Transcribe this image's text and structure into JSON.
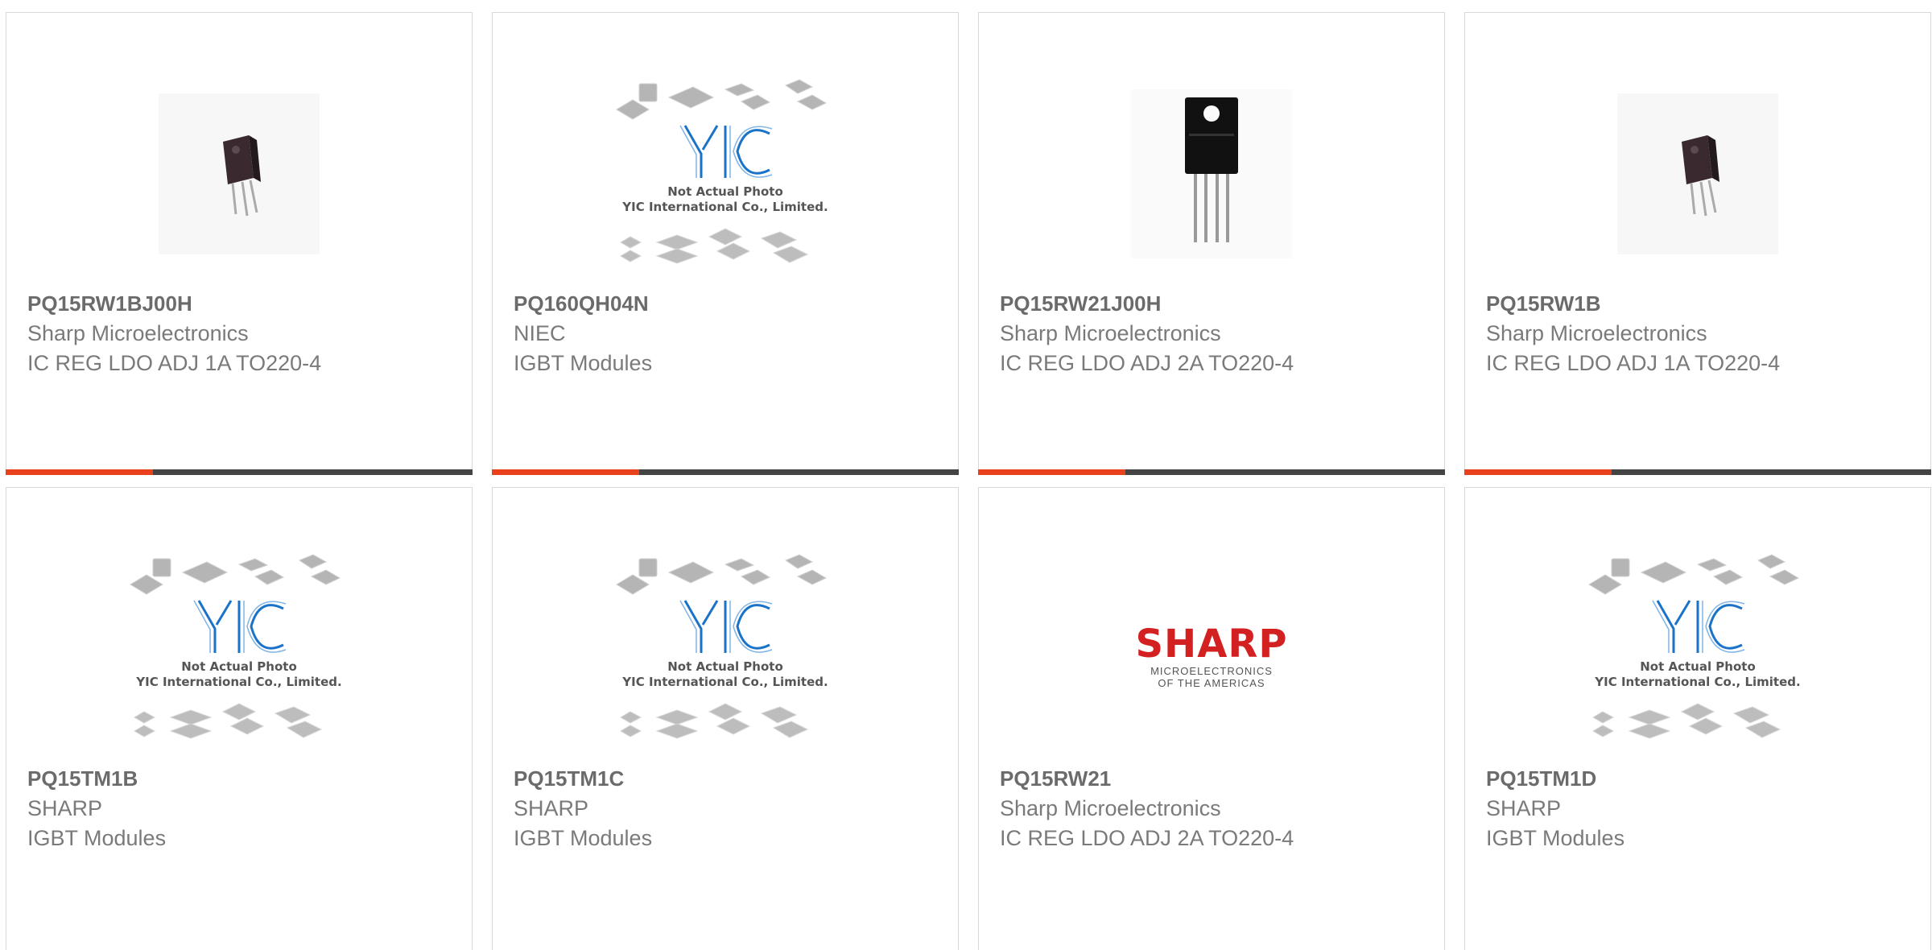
{
  "products": [
    {
      "part": "PQ15RW1BJ00H",
      "maker": "Sharp Microelectronics",
      "desc": "IC REG LDO ADJ 1A TO220-4",
      "image": "to220-small-photo"
    },
    {
      "part": "PQ160QH04N",
      "maker": "NIEC",
      "desc": "IGBT Modules",
      "image": "yic-placeholder"
    },
    {
      "part": "PQ15RW21J00H",
      "maker": "Sharp Microelectronics",
      "desc": "IC REG LDO ADJ 2A TO220-4",
      "image": "to220-large-photo"
    },
    {
      "part": "PQ15RW1B",
      "maker": "Sharp Microelectronics",
      "desc": "IC REG LDO ADJ 1A TO220-4",
      "image": "to220-small-photo"
    },
    {
      "part": "PQ15TM1B",
      "maker": "SHARP",
      "desc": "IGBT Modules",
      "image": "yic-placeholder"
    },
    {
      "part": "PQ15TM1C",
      "maker": "SHARP",
      "desc": "IGBT Modules",
      "image": "yic-placeholder"
    },
    {
      "part": "PQ15RW21",
      "maker": "Sharp Microelectronics",
      "desc": "IC REG LDO ADJ 2A TO220-4",
      "image": "sharp-logo"
    },
    {
      "part": "PQ15TM1D",
      "maker": "SHARP",
      "desc": "IGBT Modules",
      "image": "yic-placeholder"
    }
  ],
  "placeholder": {
    "line1": "Not Actual Photo",
    "line2": "YIC International Co., Limited.",
    "logo": "YIC"
  },
  "sharp_logo": {
    "word": "SHARP",
    "sub1": "MICROELECTRONICS",
    "sub2": "OF THE AMERICAS"
  },
  "colors": {
    "accent": "#e8411b",
    "bar": "#444444",
    "sharp_red": "#d32020",
    "yic_blue": "#1a73c9"
  }
}
